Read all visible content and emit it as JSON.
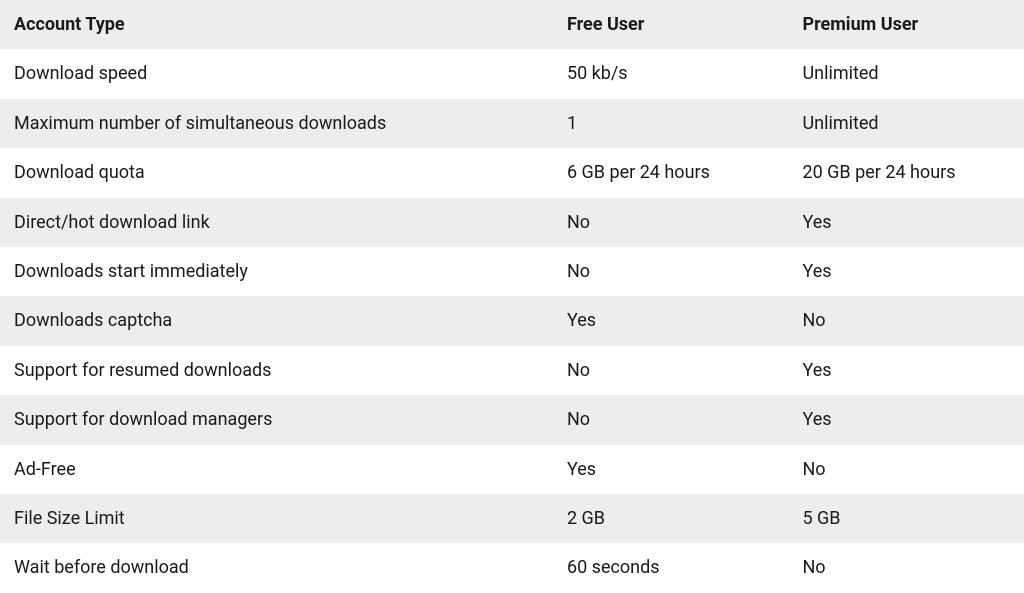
{
  "table": {
    "headers": {
      "feature": "Account Type",
      "free": "Free User",
      "premium": "Premium User"
    },
    "rows": [
      {
        "feature": "Download speed",
        "free": "50 kb/s",
        "premium": "Unlimited"
      },
      {
        "feature": "Maximum number of simultaneous downloads",
        "free": "1",
        "premium": "Unlimited"
      },
      {
        "feature": "Download quota",
        "free": "6 GB per 24 hours",
        "premium": "20 GB per 24 hours"
      },
      {
        "feature": "Direct/hot download link",
        "free": "No",
        "premium": "Yes"
      },
      {
        "feature": "Downloads start immediately",
        "free": "No",
        "premium": "Yes"
      },
      {
        "feature": "Downloads captcha",
        "free": "Yes",
        "premium": "No"
      },
      {
        "feature": "Support for resumed downloads",
        "free": "No",
        "premium": "Yes"
      },
      {
        "feature": "Support for download managers",
        "free": "No",
        "premium": "Yes"
      },
      {
        "feature": "Ad-Free",
        "free": "Yes",
        "premium": "No"
      },
      {
        "feature": "File Size Limit",
        "free": "2 GB",
        "premium": "5 GB"
      },
      {
        "feature": "Wait before download",
        "free": "60 seconds",
        "premium": "No"
      }
    ]
  }
}
